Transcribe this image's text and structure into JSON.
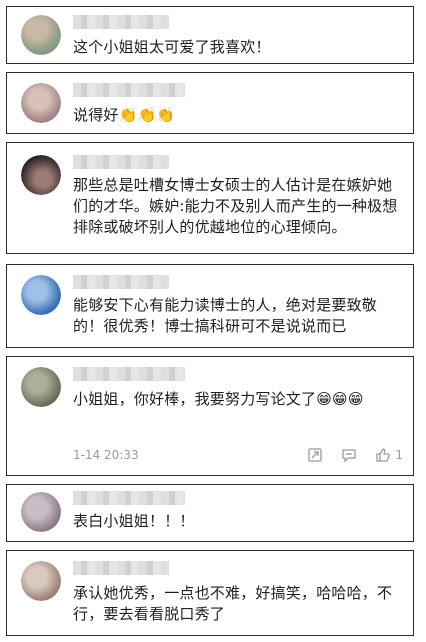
{
  "comments": [
    {
      "text": "这个小姐姐太可爱了我喜欢！",
      "avatar_colors": [
        "#8fa08a",
        "#c7b7a3"
      ]
    },
    {
      "text": "说得好👏👏👏",
      "avatar_colors": [
        "#a58a86",
        "#d7c1b8"
      ]
    },
    {
      "text": "那些总是吐槽女博士女硕士的人估计是在嫉妒她们的才华。嫉妒:能力不及别人而产生的一种极想排除或破坏别人的优越地位的心理倾向。",
      "avatar_colors": [
        "#2b2525",
        "#9c7b73"
      ]
    },
    {
      "text": "能够安下心有能力读博士的人，绝对是要致敬的！很优秀！博士搞科研可不是说说而已",
      "avatar_colors": [
        "#3b6fb4",
        "#9ec0e8"
      ]
    },
    {
      "text": "小姐姐，你好棒，我要努力写论文了😁😁😁",
      "avatar_colors": [
        "#6b6b57",
        "#aab09a"
      ],
      "timestamp": "1-14 20:33",
      "like_count": "1"
    },
    {
      "text": "表白小姐姐！！！",
      "avatar_colors": [
        "#8a7a86",
        "#c9bcc6"
      ]
    },
    {
      "text": "承认她优秀，一点也不难，好搞笑，哈哈哈，不行，要去看看脱口秀了",
      "avatar_colors": [
        "#9b7f73",
        "#d8c8bd"
      ]
    }
  ]
}
